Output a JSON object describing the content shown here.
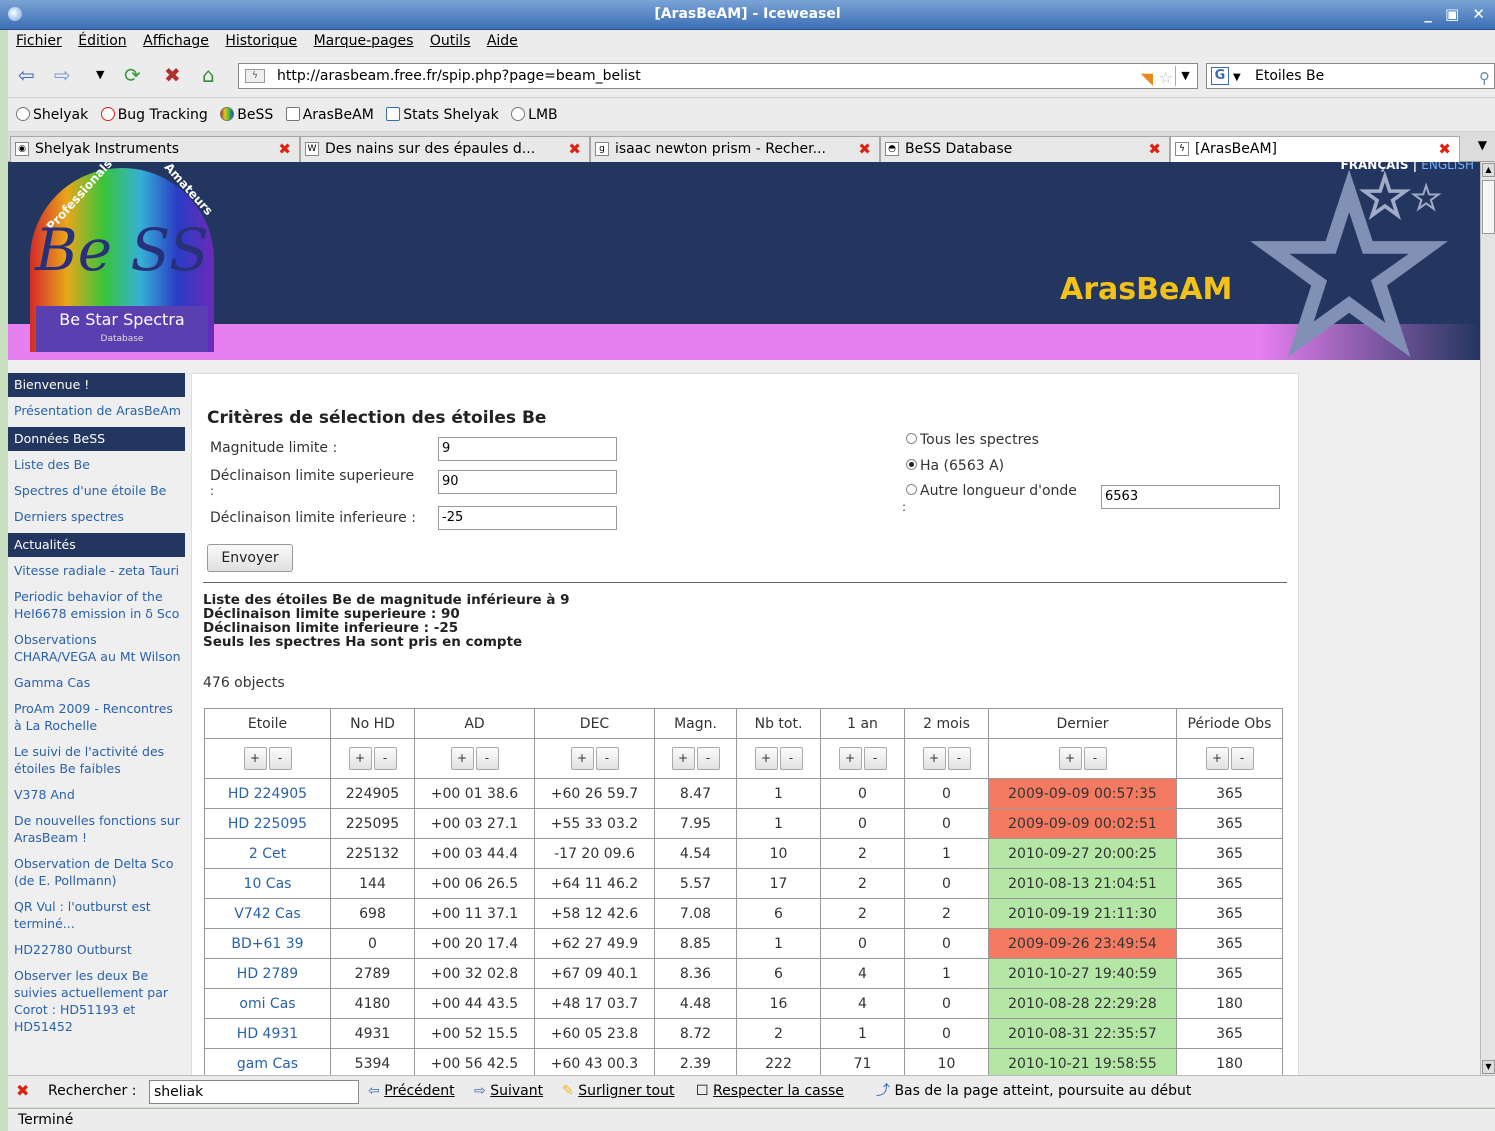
{
  "window": {
    "title": "[ArasBeAM] - Iceweasel",
    "controls": "_ ▣ ✕"
  },
  "menu": [
    "Fichier",
    "Édition",
    "Affichage",
    "Historique",
    "Marque-pages",
    "Outils",
    "Aide"
  ],
  "nav": {
    "url": "http://arasbeam.free.fr/spip.php?page=beam_belist",
    "search_value": "Etoiles Be",
    "search_engine": "G"
  },
  "bookmarks": [
    "Shelyak",
    "Bug Tracking",
    "BeSS",
    "ArasBeAM",
    "Stats Shelyak",
    "LMB"
  ],
  "tabs": [
    {
      "label": "Shelyak Instruments",
      "icon": "◉"
    },
    {
      "label": "Des nains sur des épaules d...",
      "icon": "W"
    },
    {
      "label": "isaac newton prism - Recher...",
      "icon": "g"
    },
    {
      "label": "BeSS Database",
      "icon": "◓"
    },
    {
      "label": "[ArasBeAM]",
      "icon": "ϟ"
    }
  ],
  "banner": {
    "lang_fr": "FRANÇAIS",
    "lang_sep": " | ",
    "lang_en": "ENGLISH",
    "site_name": "ArasBeAM",
    "logo_pro": "Professionals",
    "logo_ama": "Amateurs",
    "logo_text": "Be SS",
    "logo_sub": "Be Star Spectra",
    "logo_sub2": "Database"
  },
  "sidebar": {
    "s1": "Bienvenue !",
    "l1": "Présentation de ArasBeAm",
    "s2": "Données BeSS",
    "l2": "Liste des Be",
    "l3": "Spectres d'une étoile Be",
    "l4": "Derniers spectres",
    "s3": "Actualités",
    "news": [
      "Vitesse radiale - zeta Tauri",
      "Periodic behavior of the HeI6678 emission in δ Sco",
      "Observations CHARA/VEGA au Mt Wilson",
      "Gamma Cas",
      "ProAm 2009 - Rencontres à La Rochelle",
      "Le suivi de l'activité des étoiles Be faibles",
      "V378 And",
      "De nouvelles fonctions sur ArasBeam !",
      "Observation de Delta Sco (de E. Pollmann)",
      "QR Vul : l'outburst est terminé...",
      "HD22780 Outburst",
      "Observer les deux Be suivies actuellement par Corot : HD51193 et HD51452"
    ]
  },
  "form": {
    "title": "Critères de sélection des étoiles Be",
    "mag_label": "Magnitude limite :",
    "mag_value": "9",
    "dec_sup_label": "Déclinaison limite superieure",
    "dec_sup_colon": ":",
    "dec_sup_value": "90",
    "dec_inf_label": "Déclinaison limite inferieure :",
    "dec_inf_value": "-25",
    "radio_all": "Tous les spectres",
    "radio_ha": "Ha (6563 A)",
    "radio_other": "Autre longueur d'onde",
    "radio_other_colon": ":",
    "other_value": "6563",
    "submit": "Envoyer"
  },
  "results": {
    "line1": "Liste des étoiles Be de magnitude inférieure à 9",
    "line2": "Déclinaison limite superieure : 90",
    "line3": "Déclinaison limite inferieure : -25",
    "line4": "Seuls les spectres Ha sont pris en compte",
    "count": "476 objects"
  },
  "table": {
    "headers": [
      "Etoile",
      "No HD",
      "AD",
      "DEC",
      "Magn.",
      "Nb tot.",
      "1 an",
      "2 mois",
      "Dernier",
      "Période Obs"
    ],
    "sort_plus": "+",
    "sort_minus": "-",
    "status_colors": {
      "recent": "#b4e6a6",
      "old": "#f47b62"
    },
    "rows": [
      {
        "etoile": "HD 224905",
        "hd": "224905",
        "ad": "+00 01 38.6",
        "dec": "+60 26 59.7",
        "magn": "8.47",
        "nbtot": "1",
        "an": "0",
        "mois": "0",
        "dernier": "2009-09-09 00:57:35",
        "periode": "365",
        "status": "old"
      },
      {
        "etoile": "HD 225095",
        "hd": "225095",
        "ad": "+00 03 27.1",
        "dec": "+55 33 03.2",
        "magn": "7.95",
        "nbtot": "1",
        "an": "0",
        "mois": "0",
        "dernier": "2009-09-09 00:02:51",
        "periode": "365",
        "status": "old"
      },
      {
        "etoile": "2 Cet",
        "hd": "225132",
        "ad": "+00 03 44.4",
        "dec": "-17 20 09.6",
        "magn": "4.54",
        "nbtot": "10",
        "an": "2",
        "mois": "1",
        "dernier": "2010-09-27 20:00:25",
        "periode": "365",
        "status": "recent"
      },
      {
        "etoile": "10 Cas",
        "hd": "144",
        "ad": "+00 06 26.5",
        "dec": "+64 11 46.2",
        "magn": "5.57",
        "nbtot": "17",
        "an": "2",
        "mois": "0",
        "dernier": "2010-08-13 21:04:51",
        "periode": "365",
        "status": "recent"
      },
      {
        "etoile": "V742 Cas",
        "hd": "698",
        "ad": "+00 11 37.1",
        "dec": "+58 12 42.6",
        "magn": "7.08",
        "nbtot": "6",
        "an": "2",
        "mois": "2",
        "dernier": "2010-09-19 21:11:30",
        "periode": "365",
        "status": "recent"
      },
      {
        "etoile": "BD+61 39",
        "hd": "0",
        "ad": "+00 20 17.4",
        "dec": "+62 27 49.9",
        "magn": "8.85",
        "nbtot": "1",
        "an": "0",
        "mois": "0",
        "dernier": "2009-09-26 23:49:54",
        "periode": "365",
        "status": "old"
      },
      {
        "etoile": "HD 2789",
        "hd": "2789",
        "ad": "+00 32 02.8",
        "dec": "+67 09 40.1",
        "magn": "8.36",
        "nbtot": "6",
        "an": "4",
        "mois": "1",
        "dernier": "2010-10-27 19:40:59",
        "periode": "365",
        "status": "recent"
      },
      {
        "etoile": "omi Cas",
        "hd": "4180",
        "ad": "+00 44 43.5",
        "dec": "+48 17 03.7",
        "magn": "4.48",
        "nbtot": "16",
        "an": "4",
        "mois": "0",
        "dernier": "2010-08-28 22:29:28",
        "periode": "180",
        "status": "recent"
      },
      {
        "etoile": "HD 4931",
        "hd": "4931",
        "ad": "+00 52 15.5",
        "dec": "+60 05 23.8",
        "magn": "8.72",
        "nbtot": "2",
        "an": "1",
        "mois": "0",
        "dernier": "2010-08-31 22:35:57",
        "periode": "365",
        "status": "recent"
      },
      {
        "etoile": "gam Cas",
        "hd": "5394",
        "ad": "+00 56 42.5",
        "dec": "+60 43 00.3",
        "magn": "2.39",
        "nbtot": "222",
        "an": "71",
        "mois": "10",
        "dernier": "2010-10-21 19:58:55",
        "periode": "180",
        "status": "recent"
      }
    ]
  },
  "findbar": {
    "label": "Rechercher :",
    "value": "sheliak",
    "prev": "Précédent",
    "next": "Suivant",
    "highlight": "Surligner tout",
    "case": "Respecter la casse",
    "wrap": "Bas de la page atteint, poursuite au début"
  },
  "status": "Terminé"
}
